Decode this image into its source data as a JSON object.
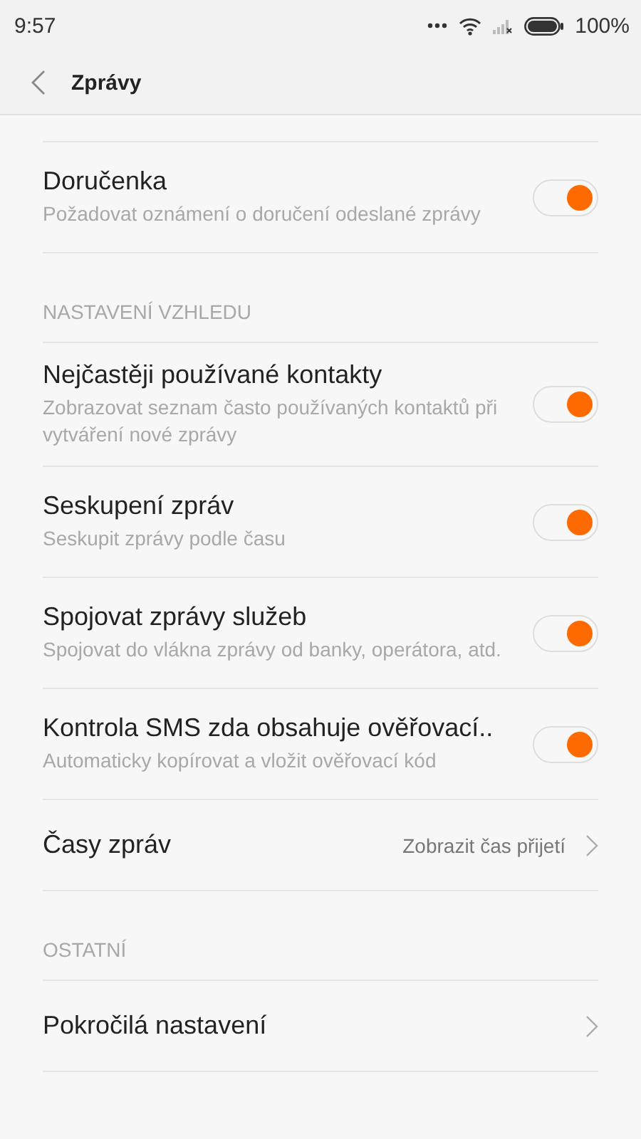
{
  "status_bar": {
    "time": "9:57",
    "battery": "100%"
  },
  "header": {
    "title": "Zprávy"
  },
  "items": [
    {
      "kind": "toggle",
      "title": "Doručenka",
      "subtitle": "Požadovat oznámení o doručení odeslané zprávy",
      "on": true
    },
    {
      "kind": "section",
      "title": "NASTAVENÍ VZHLEDU"
    },
    {
      "kind": "toggle",
      "title": "Nejčastěji používané kontakty",
      "subtitle": "Zobrazovat seznam často používaných kontaktů při vytváření nové zprávy",
      "on": true
    },
    {
      "kind": "toggle",
      "title": "Seskupení zpráv",
      "subtitle": "Seskupit zprávy podle času",
      "on": true
    },
    {
      "kind": "toggle",
      "title": "Spojovat zprávy služeb",
      "subtitle": "Spojovat do vlákna zprávy od banky, operátora, atd.",
      "on": true
    },
    {
      "kind": "toggle",
      "title": "Kontrola SMS zda obsahuje ověřovací..",
      "subtitle": "Automaticky kopírovat a vložit ověřovací kód",
      "on": true
    },
    {
      "kind": "nav",
      "title": "Časy zpráv",
      "value": "Zobrazit čas přijetí"
    },
    {
      "kind": "section",
      "title": "OSTATNÍ"
    },
    {
      "kind": "nav",
      "title": "Pokročilá nastavení"
    }
  ]
}
